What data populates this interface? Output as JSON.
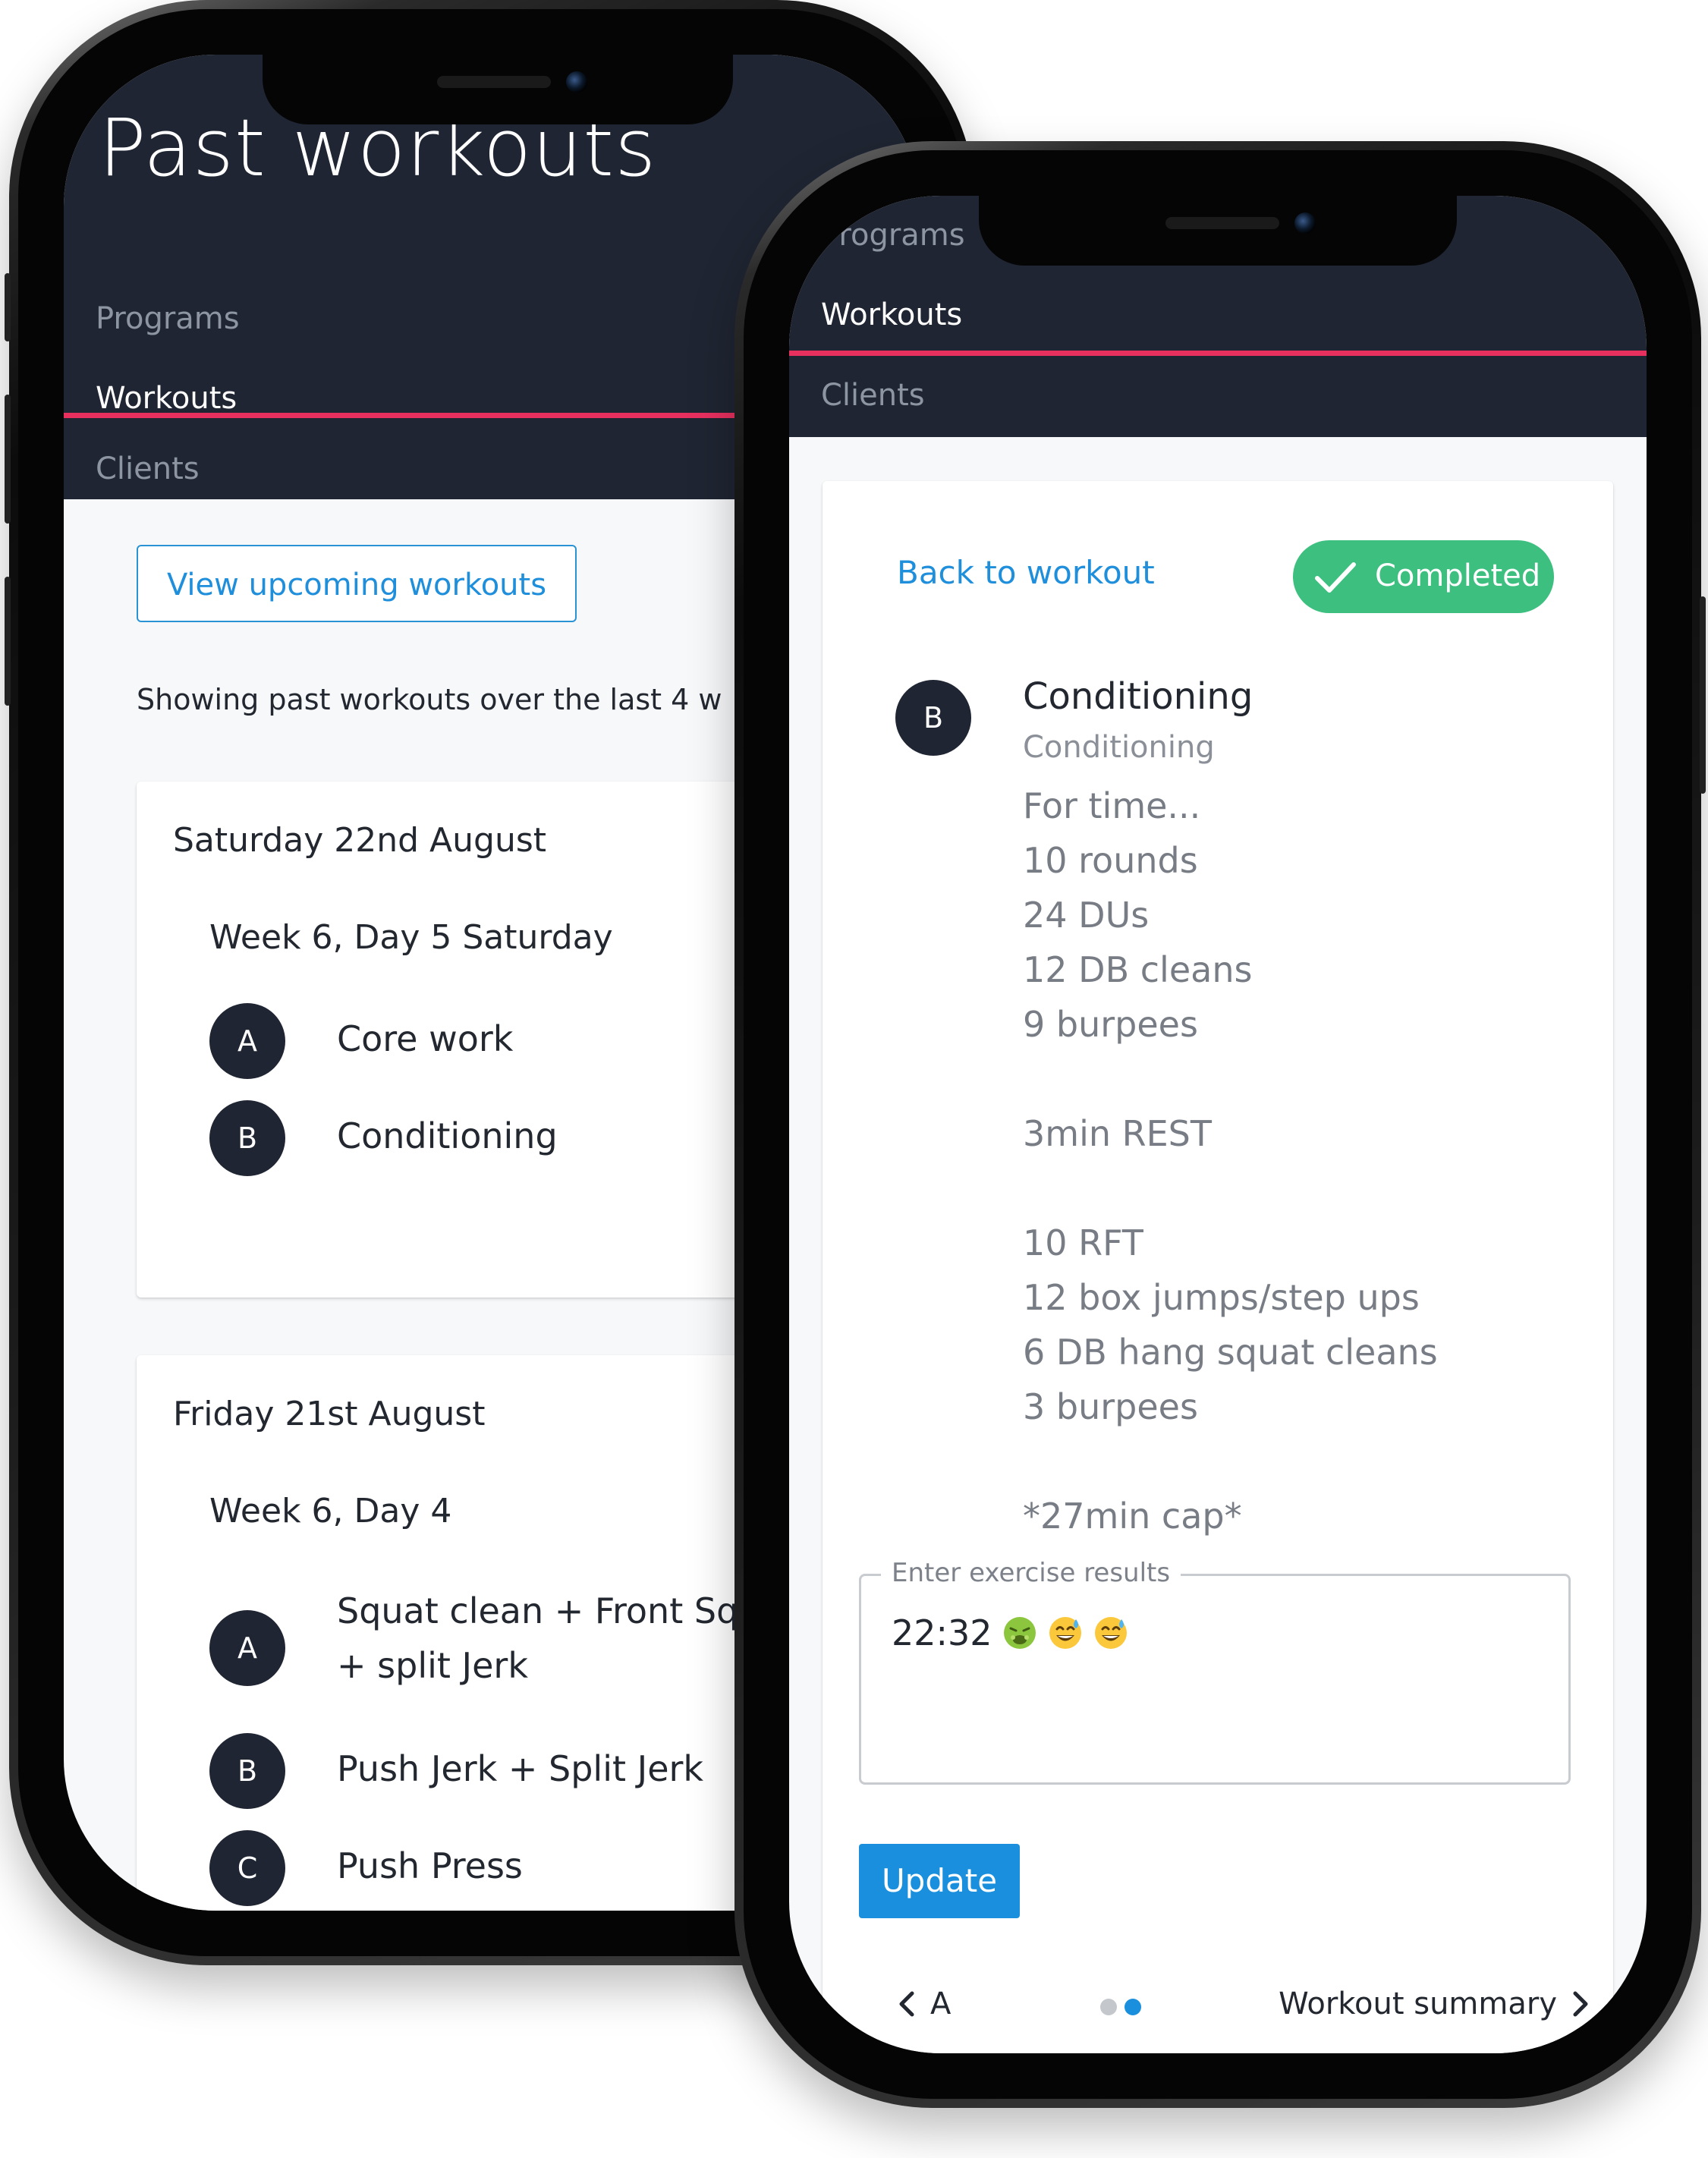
{
  "left_phone": {
    "page_title": "Past workouts",
    "nav": {
      "programs": "Programs",
      "workouts": "Workouts",
      "clients": "Clients"
    },
    "view_upcoming_label": "View upcoming workouts",
    "showing_text": "Showing past workouts over the last 4 w",
    "days": [
      {
        "date": "Saturday 22nd August",
        "session": "Week 6, Day 5 Saturday",
        "exercises": [
          {
            "letter": "A",
            "name": "Core work"
          },
          {
            "letter": "B",
            "name": "Conditioning"
          }
        ]
      },
      {
        "date": "Friday 21st August",
        "session": "Week 6, Day 4",
        "exercises": [
          {
            "letter": "A",
            "name_line1": "Squat clean + Front Squ",
            "name_line2": "+ split Jerk"
          },
          {
            "letter": "B",
            "name": "Push Jerk + Split Jerk"
          },
          {
            "letter": "C",
            "name": "Push Press"
          }
        ]
      }
    ]
  },
  "right_phone": {
    "nav": {
      "programs": "Programs",
      "workouts": "Workouts",
      "clients": "Clients"
    },
    "back_link": "Back to workout",
    "status_badge": "Completed",
    "exercise": {
      "letter": "B",
      "title": "Conditioning",
      "category": "Conditioning",
      "description_lines": [
        "For time...",
        "10 rounds",
        "24 DUs",
        "12 DB cleans",
        "9 burpees",
        "",
        "3min REST",
        "",
        "10 RFT",
        "12 box jumps/step ups",
        "6 DB hang squat cleans",
        "3 burpees",
        "",
        "*27min cap*"
      ]
    },
    "results_field": {
      "label": "Enter exercise results",
      "value": "22:32",
      "emojis": [
        "nauseated-face",
        "grinning-sweat-face",
        "grinning-sweat-face"
      ]
    },
    "update_button": "Update",
    "pager": {
      "prev_label": "A",
      "next_label": "Workout summary",
      "active_dot": 1,
      "dot_count": 2
    }
  },
  "colors": {
    "header_bg": "#1f2532",
    "accent_pink": "#e8305f",
    "link_blue": "#1f8fdc",
    "success_green": "#3cbf7f",
    "button_blue": "#1a8fdd"
  }
}
